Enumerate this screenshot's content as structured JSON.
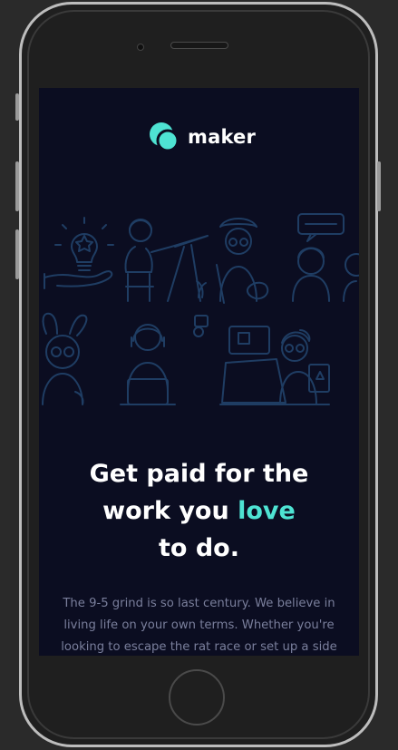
{
  "brand": {
    "name": "maker",
    "logo_icon": "maker-logo-icon",
    "accent_color": "#4ee3d3"
  },
  "hero": {
    "headline_part1": "Get paid for the",
    "headline_part2": "work you",
    "headline_accent": "love",
    "headline_part3": "to do.",
    "description": "The 9-5 grind is so last century. We believe in living life on your own terms. Whether you're looking to escape the rat race or set up a side"
  },
  "colors": {
    "background": "#0b0d21",
    "illustration_stroke": "#1f3d63",
    "text_muted": "#7a7f9c"
  }
}
